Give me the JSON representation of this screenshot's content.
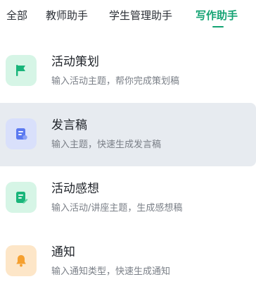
{
  "tabs": [
    {
      "label": "全部",
      "active": false
    },
    {
      "label": "教师助手",
      "active": false
    },
    {
      "label": "学生管理助手",
      "active": false
    },
    {
      "label": "写作助手",
      "active": true
    }
  ],
  "items": [
    {
      "title": "活动策划",
      "description": "输入活动主题，帮你完成策划稿",
      "icon": "flag-icon",
      "icon_bg": "#d6f5e6",
      "icon_color": "#19b57a"
    },
    {
      "title": "发言稿",
      "description": "输入主题，快速生成发言稿",
      "icon": "speech-doc-icon",
      "icon_bg": "#d9e0fb",
      "icon_color": "#5b79f0"
    },
    {
      "title": "活动感想",
      "description": "输入活动/讲座主题，生成感想稿",
      "icon": "edit-doc-icon",
      "icon_bg": "#d6f5e6",
      "icon_color": "#19b57a"
    },
    {
      "title": "通知",
      "description": "输入通知类型，快速生成通知",
      "icon": "bell-icon",
      "icon_bg": "#fde6c8",
      "icon_color": "#f5a030"
    }
  ],
  "colors": {
    "accent": "#14a373",
    "highlight_bg": "#e7ebf0"
  }
}
